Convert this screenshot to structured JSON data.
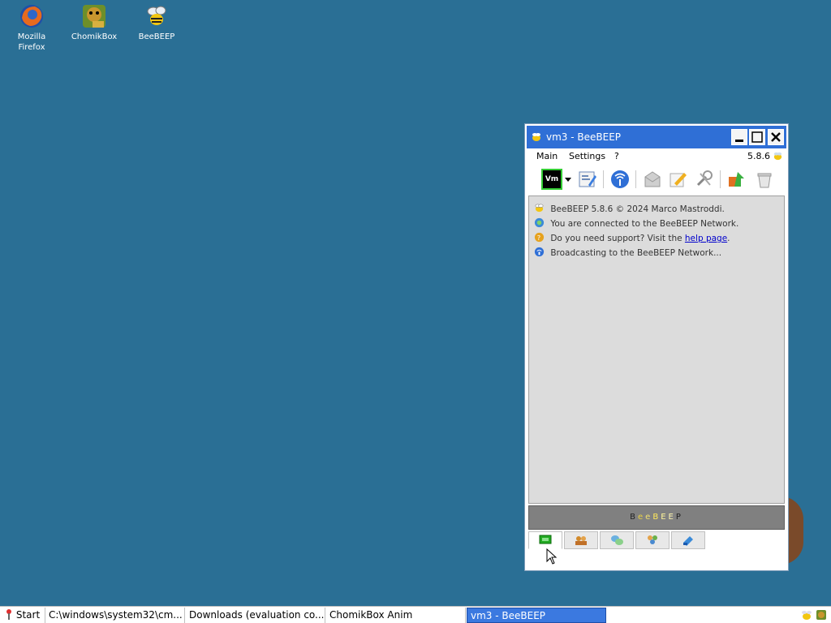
{
  "desktop": {
    "icons": [
      {
        "label": "Mozilla\nFirefox",
        "icon": "firefox-icon"
      },
      {
        "label": "ChomikBox",
        "icon": "chomikbox-icon"
      },
      {
        "label": "BeeBEEP",
        "icon": "beebeep-icon"
      }
    ]
  },
  "window": {
    "title": "vm3 - BeeBEEP",
    "menu": {
      "main": "Main",
      "settings": "Settings",
      "help": "?",
      "version": "5.8.6"
    },
    "toolbar": {
      "user_badge": "Vm"
    },
    "messages": [
      {
        "text": "BeeBEEP 5.8.6 © 2024 Marco Mastroddi.",
        "icon": "bee-icon"
      },
      {
        "text": "You are connected to the BeeBEEP Network.",
        "icon": "connected-icon"
      },
      {
        "prefix": "Do you need support? Visit the ",
        "link": "help page",
        "suffix": ".",
        "icon": "support-icon"
      },
      {
        "text": "Broadcasting to the BeeBEEP Network...",
        "icon": "broadcast-icon"
      }
    ],
    "logo_text": "BeeBEEP"
  },
  "taskbar": {
    "start": "Start",
    "tasks": [
      "C:\\windows\\system32\\cm...",
      "Downloads (evaluation co...",
      "ChomikBox Anim",
      "vm3 - BeeBEEP"
    ]
  },
  "colors": {
    "desktop": "#2a6f95",
    "titlebar": "#2f6fd6",
    "accent_green": "#33cc33"
  }
}
